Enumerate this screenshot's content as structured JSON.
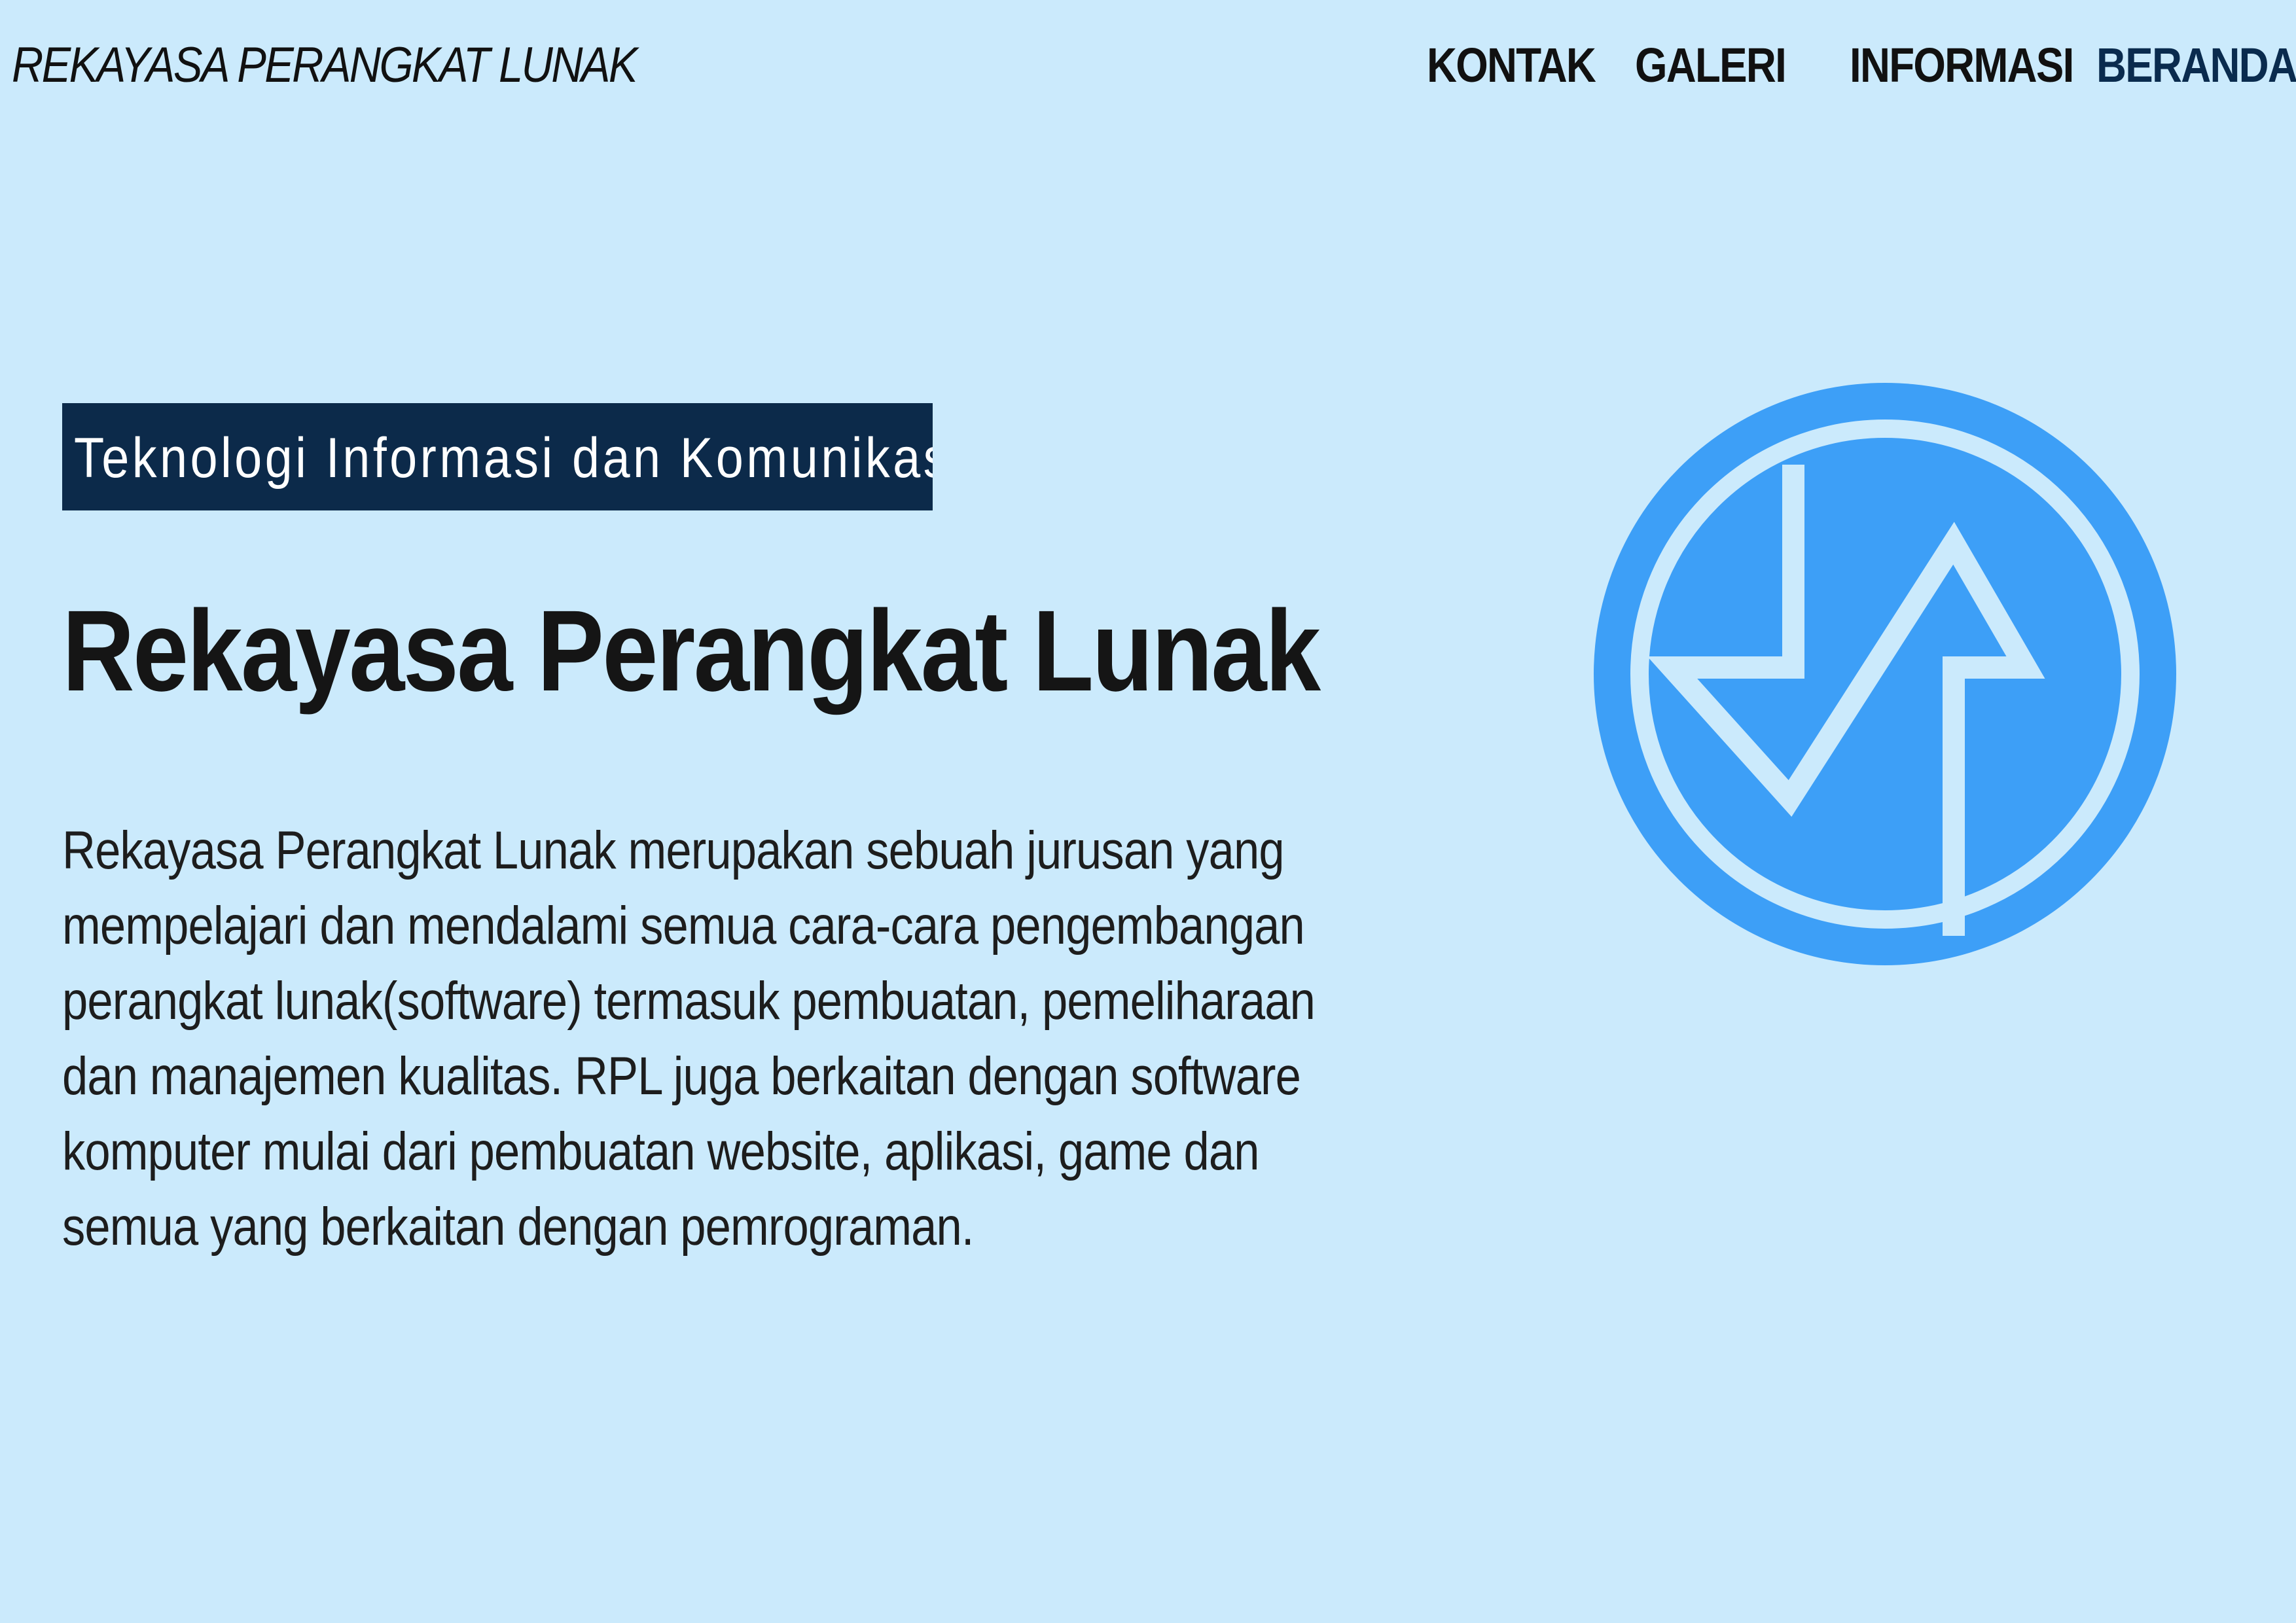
{
  "header": {
    "brand": "REKAYASA PERANGKAT LUNAK",
    "nav": [
      {
        "label": "KONTAK"
      },
      {
        "label": "GALERI"
      },
      {
        "label": "INFORMASI"
      },
      {
        "label": "BERANDA"
      }
    ]
  },
  "hero": {
    "tag": "Teknologi Informasi dan Komunikasi",
    "title": "Rekayasa Perangkat Lunak",
    "description": "Rekayasa Perangkat Lunak merupakan sebuah jurusan yang mempelajari dan mendalami semua cara-cara pengembangan perangkat lunak(software) termasuk pembuatan, pemeliharaan dan manajemen kualitas. RPL juga berkaitan dengan software komputer mulai dari pembuatan website, aplikasi, game dan semua yang berkaitan dengan pemrograman.",
    "logo_icon": "rpl-arrows-circle-icon"
  },
  "colors": {
    "background": "#cbeafc",
    "badge_background": "#0c2a4a",
    "logo_blue": "#3d9ff7",
    "text": "#151515"
  }
}
